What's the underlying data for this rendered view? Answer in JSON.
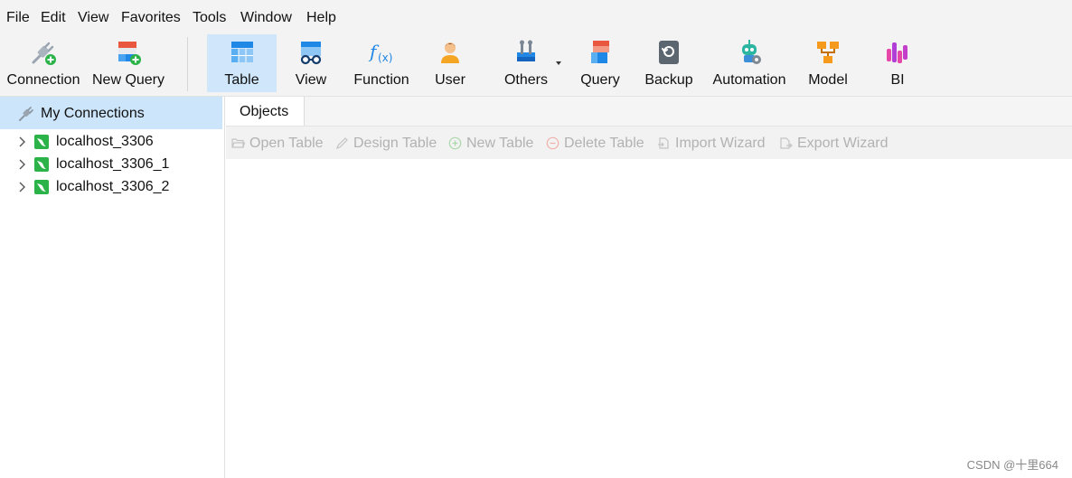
{
  "menu": [
    "File",
    "Edit",
    "View",
    "Favorites",
    "Tools",
    "Window",
    "Help"
  ],
  "toolbar": {
    "items": [
      {
        "label": "Connection",
        "icon": "connection-icon"
      },
      {
        "label": "New Query",
        "icon": "new-query-icon"
      },
      {
        "label": "Table",
        "icon": "table-icon",
        "active": true
      },
      {
        "label": "View",
        "icon": "view-icon"
      },
      {
        "label": "Function",
        "icon": "function-icon"
      },
      {
        "label": "User",
        "icon": "user-icon"
      },
      {
        "label": "Others",
        "icon": "others-icon",
        "has_dropdown": true
      },
      {
        "label": "Query",
        "icon": "query-icon"
      },
      {
        "label": "Backup",
        "icon": "backup-icon"
      },
      {
        "label": "Automation",
        "icon": "automation-icon"
      },
      {
        "label": "Model",
        "icon": "model-icon"
      },
      {
        "label": "BI",
        "icon": "bi-icon"
      }
    ]
  },
  "sidebar": {
    "header": "My Connections",
    "connections": [
      "localhost_3306",
      "localhost_3306_1",
      "localhost_3306_2"
    ]
  },
  "main": {
    "tab": "Objects",
    "actions": [
      "Open Table",
      "Design Table",
      "New Table",
      "Delete Table",
      "Import Wizard",
      "Export Wizard"
    ]
  },
  "watermark": "CSDN @十里664",
  "colors": {
    "active_tool_bg": "#cfe6fb",
    "selected_row_bg": "#cce5fb",
    "mysql_green": "#2bb34a",
    "disabled_text": "#b2b2b2"
  }
}
